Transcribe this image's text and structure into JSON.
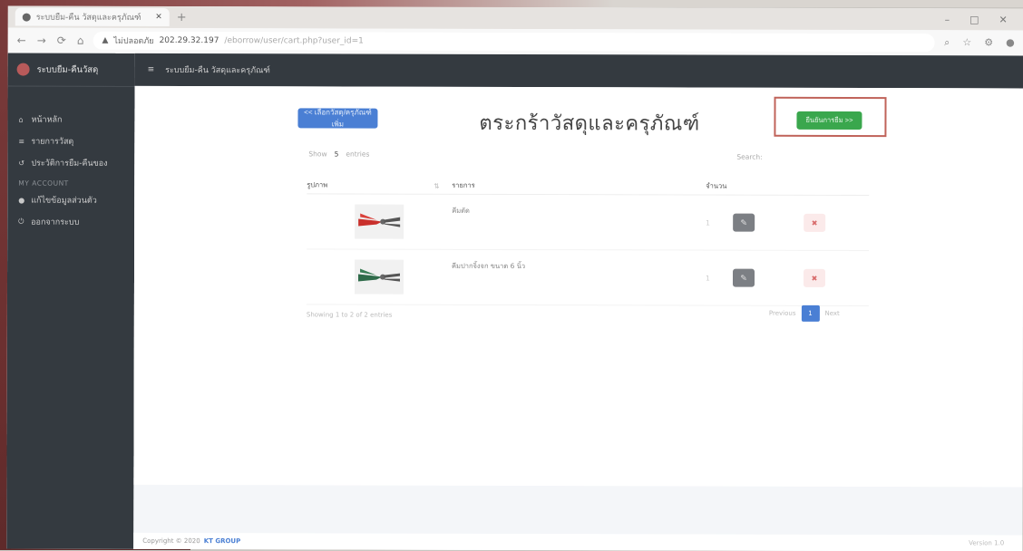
{
  "browser": {
    "tab_title": "ระบบยืม-คืน วัสดุและครุภัณฑ์",
    "new_tab": "+",
    "window_controls": [
      "–",
      "□",
      "✕"
    ],
    "security_label": "ไม่ปลอดภัย",
    "url_host": "202.29.32.197",
    "url_path": "/eborrow/user/cart.php?user_id=1",
    "nav_icons": [
      "back-icon",
      "forward-icon",
      "reload-icon",
      "home-icon"
    ]
  },
  "sidebar": {
    "brand": "ระบบยืม-คืนวัสดุ",
    "items": [
      {
        "icon": "home-icon",
        "label": "หน้าหลัก"
      },
      {
        "icon": "list-icon",
        "label": "รายการวัสดุ"
      },
      {
        "icon": "history-icon",
        "label": "ประวัติการยืม-คืนของ"
      }
    ],
    "section_header": "MY ACCOUNT",
    "account_items": [
      {
        "icon": "user-icon",
        "label": "แก้ไขข้อมูลส่วนตัว"
      },
      {
        "icon": "logout-icon",
        "label": "ออกจากระบบ"
      }
    ]
  },
  "topnav": {
    "menu_icon": "hamburger-icon",
    "title": "ระบบยืม-คืน วัสดุและครุภัณฑ์"
  },
  "page": {
    "back_button": "<< เลือกวัสดุ/ครุภัณฑ์เพิ่ม",
    "title": "ตระกร้าวัสดุและครุภัณฑ์",
    "confirm_button": "ยืนยันการยืม >>",
    "show_label": "Show",
    "show_value": "5",
    "entries_label": "entries",
    "search_label": "Search:"
  },
  "table": {
    "columns": [
      "รูปภาพ",
      "รายการ",
      "จำนวน"
    ],
    "sort_indicator": "⇅",
    "rows": [
      {
        "name": "คีมตัด",
        "qty": "1",
        "image": "pliers-red-image"
      },
      {
        "name": "คีมปากจิ้งจก ขนาด 6 นิ้ว",
        "qty": "1",
        "image": "pliers-green-image"
      }
    ],
    "edit_icon": "pencil-icon",
    "delete_icon": "trash-icon"
  },
  "pagination": {
    "info": "Showing 1 to 2 of 2 entries",
    "prev": "Previous",
    "current": "1",
    "next": "Next"
  },
  "footer": {
    "copyright": "Copyright © 2020",
    "group": "KT GROUP",
    "version": "Version 1.0"
  },
  "colors": {
    "sidebar_bg": "#343a40",
    "primary": "#4a7fd4",
    "success": "#3aa74d",
    "highlight": "#c0635a"
  }
}
